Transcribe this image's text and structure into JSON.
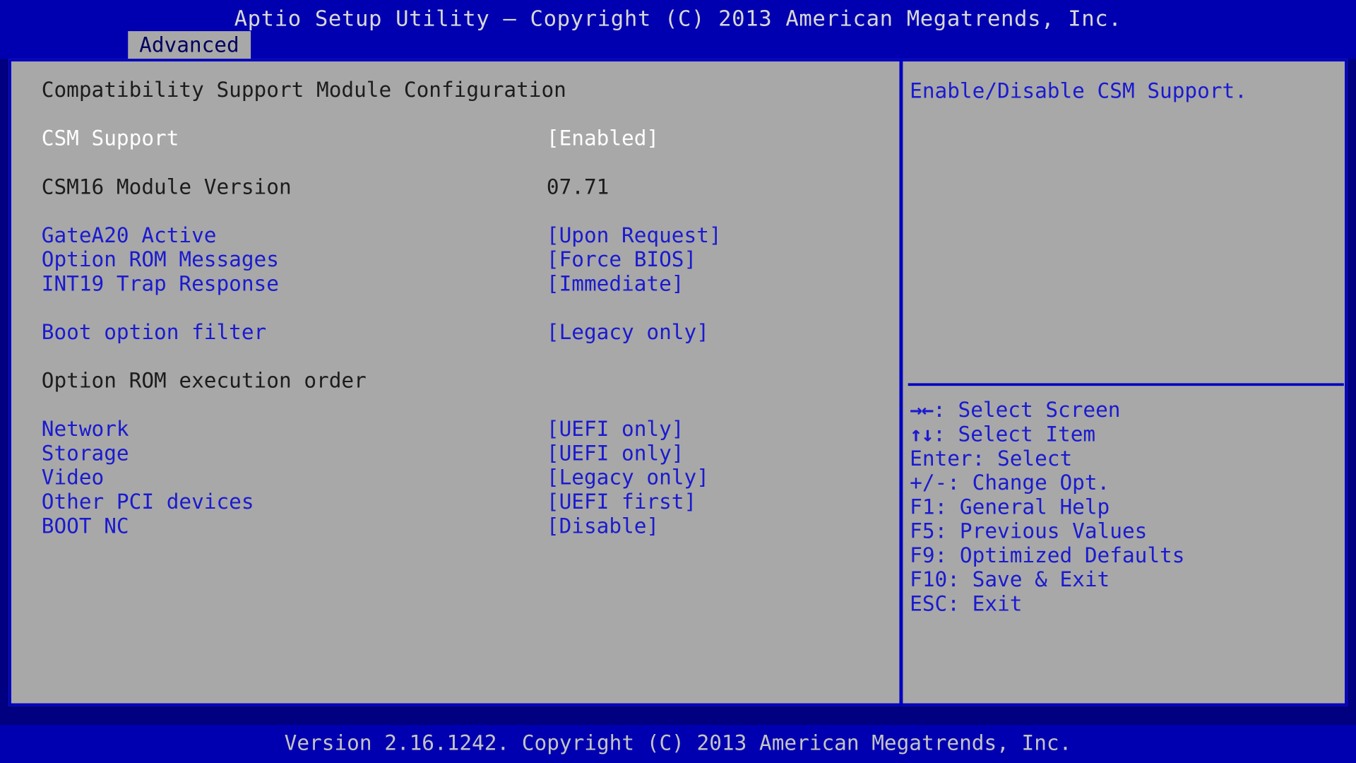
{
  "window": {
    "title": "Aptio Setup Utility – Copyright (C) 2013 American Megatrends, Inc.",
    "footer": "Version 2.16.1242. Copyright (C) 2013 American Megatrends, Inc."
  },
  "menu": {
    "tabs": [
      {
        "label": "Advanced",
        "active": true
      }
    ]
  },
  "main": {
    "section_title": "Compatibility Support Module Configuration",
    "subsection_title": "Option ROM execution order",
    "rows": [
      {
        "label": "CSM Support",
        "value": "[Enabled]",
        "label_style": "selected",
        "value_style": "selected"
      },
      {
        "label": "CSM16 Module Version",
        "value": "07.71",
        "label_style": "readonly",
        "value_style": "readonly"
      },
      {
        "label": "GateA20 Active",
        "value": "[Upon Request]",
        "label_style": "option",
        "value_style": "option"
      },
      {
        "label": "Option ROM Messages",
        "value": "[Force BIOS]",
        "label_style": "option",
        "value_style": "option"
      },
      {
        "label": "INT19 Trap Response",
        "value": "[Immediate]",
        "label_style": "option",
        "value_style": "option"
      },
      {
        "label": "Boot option filter",
        "value": "[Legacy only]",
        "label_style": "option",
        "value_style": "option"
      },
      {
        "label": "Network",
        "value": "[UEFI only]",
        "label_style": "option",
        "value_style": "option"
      },
      {
        "label": "Storage",
        "value": "[UEFI only]",
        "label_style": "option",
        "value_style": "option"
      },
      {
        "label": "Video",
        "value": "[Legacy only]",
        "label_style": "option",
        "value_style": "option"
      },
      {
        "label": "Other PCI devices",
        "value": "[UEFI first]",
        "label_style": "option",
        "value_style": "option"
      },
      {
        "label": "BOOT NC",
        "value": "[Disable]",
        "label_style": "option",
        "value_style": "option"
      }
    ]
  },
  "help": {
    "description": "Enable/Disable CSM Support.",
    "keys": [
      {
        "glyph": "→←",
        "text": ": Select Screen"
      },
      {
        "glyph": "↑↓",
        "text": ": Select Item"
      },
      {
        "glyph": "",
        "text": "Enter: Select"
      },
      {
        "glyph": "",
        "text": "+/-: Change Opt."
      },
      {
        "glyph": "",
        "text": "F1: General Help"
      },
      {
        "glyph": "",
        "text": "F5: Previous Values"
      },
      {
        "glyph": "",
        "text": "F9: Optimized Defaults"
      },
      {
        "glyph": "",
        "text": "F10: Save & Exit"
      },
      {
        "glyph": "",
        "text": "ESC: Exit"
      }
    ]
  },
  "colors": {
    "screen_blue": "#000080",
    "bar_blue": "#0000b0",
    "panel_gray": "#a8a8a8",
    "border_blue": "#0000c0",
    "option_blue": "#1a1ad0",
    "readonly_dark": "#1c1c1c",
    "selected_white": "#ffffff"
  }
}
